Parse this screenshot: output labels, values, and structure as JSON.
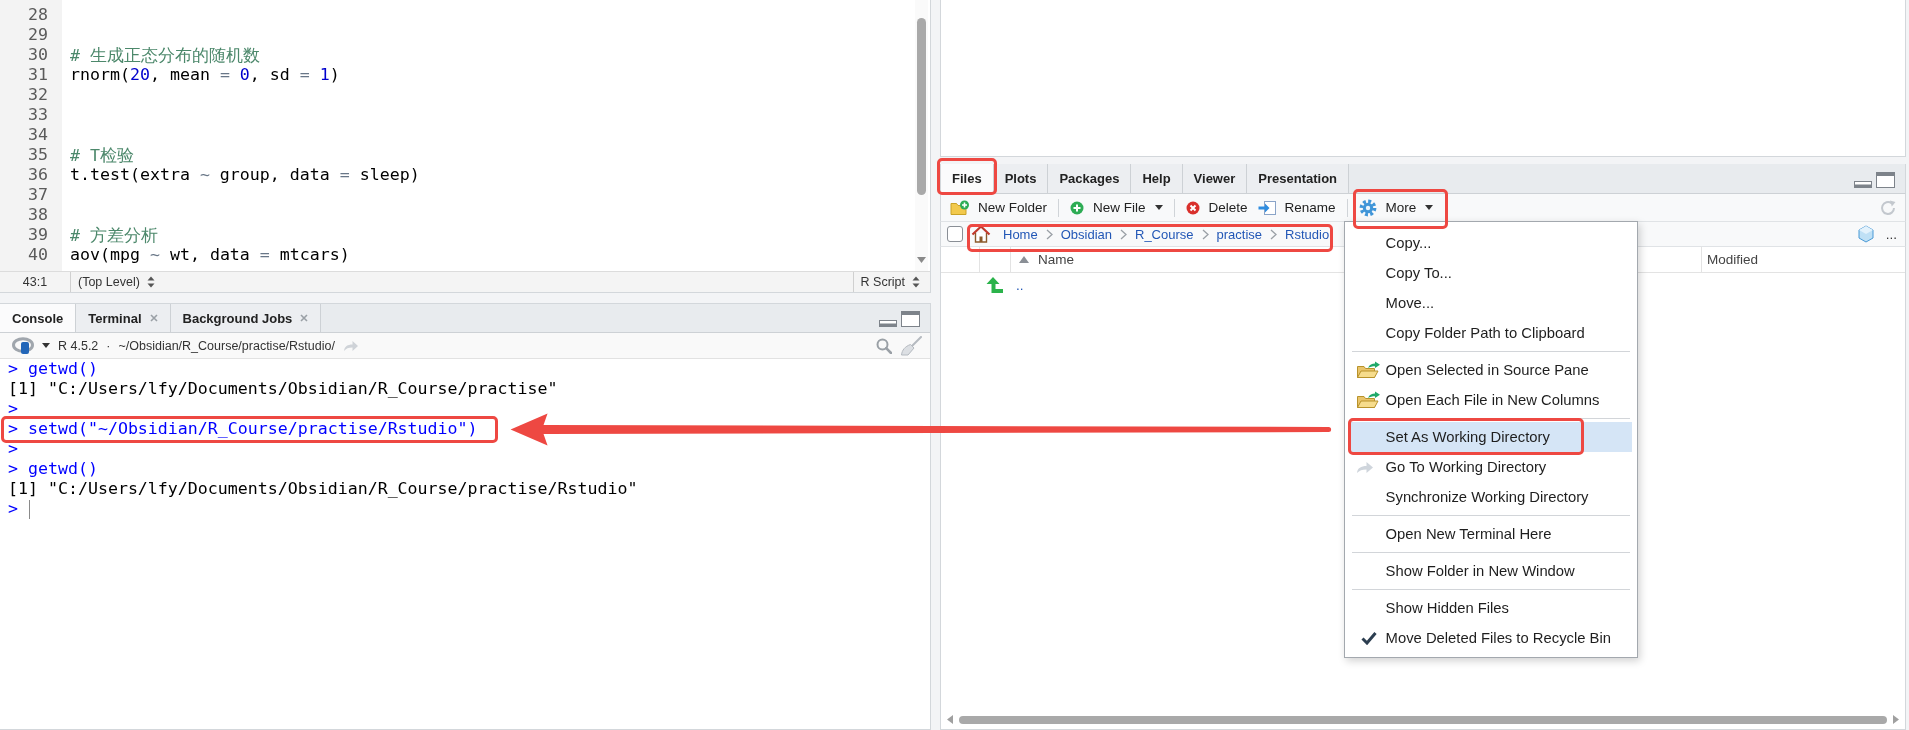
{
  "editor": {
    "lines": [
      {
        "number": "28"
      },
      {
        "number": "29"
      },
      {
        "number": "30",
        "tokens": [
          {
            "kind": "comment",
            "text": "# 生成正态分布的随机数"
          }
        ]
      },
      {
        "number": "31",
        "tokens": [
          {
            "kind": "plain",
            "text": "rnorm("
          },
          {
            "kind": "number",
            "text": "20"
          },
          {
            "kind": "plain",
            "text": ", mean "
          },
          {
            "kind": "operator",
            "text": "= "
          },
          {
            "kind": "number",
            "text": "0"
          },
          {
            "kind": "plain",
            "text": ", sd "
          },
          {
            "kind": "operator",
            "text": "= "
          },
          {
            "kind": "number",
            "text": "1"
          },
          {
            "kind": "plain",
            "text": ")"
          }
        ]
      },
      {
        "number": "32"
      },
      {
        "number": "33"
      },
      {
        "number": "34"
      },
      {
        "number": "35",
        "tokens": [
          {
            "kind": "comment",
            "text": "# T检验"
          }
        ]
      },
      {
        "number": "36",
        "tokens": [
          {
            "kind": "plain",
            "text": "t.test(extra "
          },
          {
            "kind": "operator",
            "text": "~"
          },
          {
            "kind": "plain",
            "text": " group, data "
          },
          {
            "kind": "operator",
            "text": "="
          },
          {
            "kind": "plain",
            "text": " sleep)"
          }
        ]
      },
      {
        "number": "37"
      },
      {
        "number": "38"
      },
      {
        "number": "39",
        "tokens": [
          {
            "kind": "comment",
            "text": "# 方差分析"
          }
        ]
      },
      {
        "number": "40",
        "tokens": [
          {
            "kind": "plain",
            "text": "aov(mpg "
          },
          {
            "kind": "operator",
            "text": "~"
          },
          {
            "kind": "plain",
            "text": " wt, data "
          },
          {
            "kind": "operator",
            "text": "="
          },
          {
            "kind": "plain",
            "text": " mtcars)"
          }
        ]
      }
    ],
    "status_bar": {
      "position": "43:1",
      "scope": "(Top Level)",
      "file_type": "R Script"
    }
  },
  "console": {
    "tabs": [
      {
        "label": "Console",
        "selected": true,
        "closable": false
      },
      {
        "label": "Terminal",
        "selected": false,
        "closable": true
      },
      {
        "label": "Background Jobs",
        "selected": false,
        "closable": true
      }
    ],
    "r_version": "R 4.5.2",
    "separator": "·",
    "working_directory": "~/Obsidian/R_Course/practise/Rstudio/",
    "lines": [
      {
        "kind": "input",
        "text": "> getwd()",
        "outlined": false,
        "arrow_target": false,
        "cursor": false
      },
      {
        "kind": "output",
        "text": "[1] \"C:/Users/lfy/Documents/Obsidian/R_Course/practise\"",
        "outlined": false,
        "arrow_target": false,
        "cursor": false
      },
      {
        "kind": "input",
        "text": ">",
        "outlined": false,
        "arrow_target": false,
        "cursor": false
      },
      {
        "kind": "input",
        "text": "> setwd(\"~/Obsidian/R_Course/practise/Rstudio\")",
        "outlined": true,
        "arrow_target": true,
        "cursor": false
      },
      {
        "kind": "input",
        "text": ">",
        "outlined": false,
        "arrow_target": false,
        "cursor": false
      },
      {
        "kind": "input",
        "text": "> getwd()",
        "outlined": false,
        "arrow_target": false,
        "cursor": false
      },
      {
        "kind": "output",
        "text": "[1] \"C:/Users/lfy/Documents/Obsidian/R_Course/practise/Rstudio\"",
        "outlined": false,
        "arrow_target": false,
        "cursor": false
      },
      {
        "kind": "input",
        "text": ">",
        "outlined": false,
        "arrow_target": false,
        "cursor": true
      }
    ]
  },
  "files_pane": {
    "tabs": [
      {
        "label": "Files",
        "selected": true,
        "outlined": true
      },
      {
        "label": "Plots",
        "selected": false,
        "outlined": false
      },
      {
        "label": "Packages",
        "selected": false,
        "outlined": false
      },
      {
        "label": "Help",
        "selected": false,
        "outlined": false
      },
      {
        "label": "Viewer",
        "selected": false,
        "outlined": false
      },
      {
        "label": "Presentation",
        "selected": false,
        "outlined": false
      }
    ],
    "toolbar": [
      {
        "kind": "new-folder",
        "label": "New Folder",
        "dropdown": false,
        "outlined": false
      },
      {
        "kind": "separator"
      },
      {
        "kind": "new-file",
        "label": "New File",
        "dropdown": true,
        "outlined": false
      },
      {
        "kind": "separator"
      },
      {
        "kind": "delete",
        "label": "Delete",
        "dropdown": false,
        "outlined": false
      },
      {
        "kind": "rename",
        "label": "Rename",
        "dropdown": false,
        "outlined": false
      },
      {
        "kind": "separator"
      },
      {
        "kind": "more",
        "label": "More",
        "dropdown": true,
        "outlined": true
      }
    ],
    "select_all": {
      "checked": false
    },
    "breadcrumb": {
      "outlined": true,
      "items": [
        "Home",
        "Obsidian",
        "R_Course",
        "practise",
        "Rstudio"
      ]
    },
    "ellipsis_button": "...",
    "columns": [
      {
        "label": "Name",
        "sorted_ascending": true
      },
      {
        "label": "Modified",
        "sorted_ascending": false
      }
    ],
    "rows": [
      {
        "kind": "parent",
        "name": ".."
      }
    ],
    "menu": {
      "items": [
        {
          "kind": "item",
          "label": "Copy...",
          "selected": false,
          "outlined": false
        },
        {
          "kind": "item",
          "label": "Copy To...",
          "selected": false,
          "outlined": false
        },
        {
          "kind": "item",
          "label": "Move...",
          "selected": false,
          "outlined": false
        },
        {
          "kind": "item",
          "label": "Copy Folder Path to Clipboard",
          "selected": false,
          "outlined": false
        },
        {
          "kind": "separator"
        },
        {
          "kind": "open",
          "label": "Open Selected in Source Pane",
          "selected": false,
          "outlined": false
        },
        {
          "kind": "open",
          "label": "Open Each File in New Columns",
          "selected": false,
          "outlined": false
        },
        {
          "kind": "separator"
        },
        {
          "kind": "item",
          "label": "Set As Working Directory",
          "selected": true,
          "outlined": true
        },
        {
          "kind": "goto",
          "label": "Go To Working Directory",
          "selected": false,
          "outlined": false
        },
        {
          "kind": "item",
          "label": "Synchronize Working Directory",
          "selected": false,
          "outlined": false
        },
        {
          "kind": "separator"
        },
        {
          "kind": "item",
          "label": "Open New Terminal Here",
          "selected": false,
          "outlined": false
        },
        {
          "kind": "separator"
        },
        {
          "kind": "item",
          "label": "Show Folder in New Window",
          "selected": false,
          "outlined": false
        },
        {
          "kind": "separator"
        },
        {
          "kind": "toggle",
          "label": "Show Hidden Files",
          "checked": false,
          "selected": false,
          "outlined": false
        },
        {
          "kind": "toggle",
          "label": "Move Deleted Files to Recycle Bin",
          "checked": true,
          "selected": false,
          "outlined": false
        }
      ]
    }
  }
}
